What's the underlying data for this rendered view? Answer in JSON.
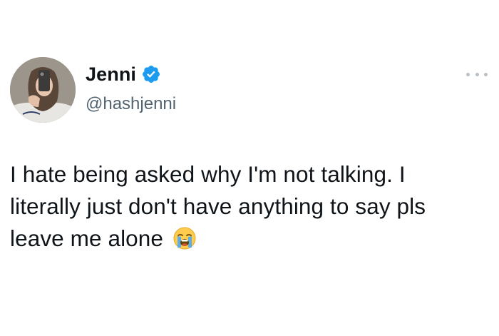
{
  "tweet": {
    "author": {
      "display_name": "Jenni",
      "handle": "@hashjenni",
      "verified": true,
      "avatar_icon": "profile-photo"
    },
    "text_line_1": "I hate being asked why I'm not talking. I",
    "text_line_2": "literally just don't have anything to say pls",
    "text_line_3": "leave me alone",
    "emoji": "loudly-crying-face",
    "more_icon": "ellipsis-icon",
    "colors": {
      "verified_blue": "#1d9bf0",
      "handle_gray": "#536471",
      "text": "#0f1419"
    }
  }
}
